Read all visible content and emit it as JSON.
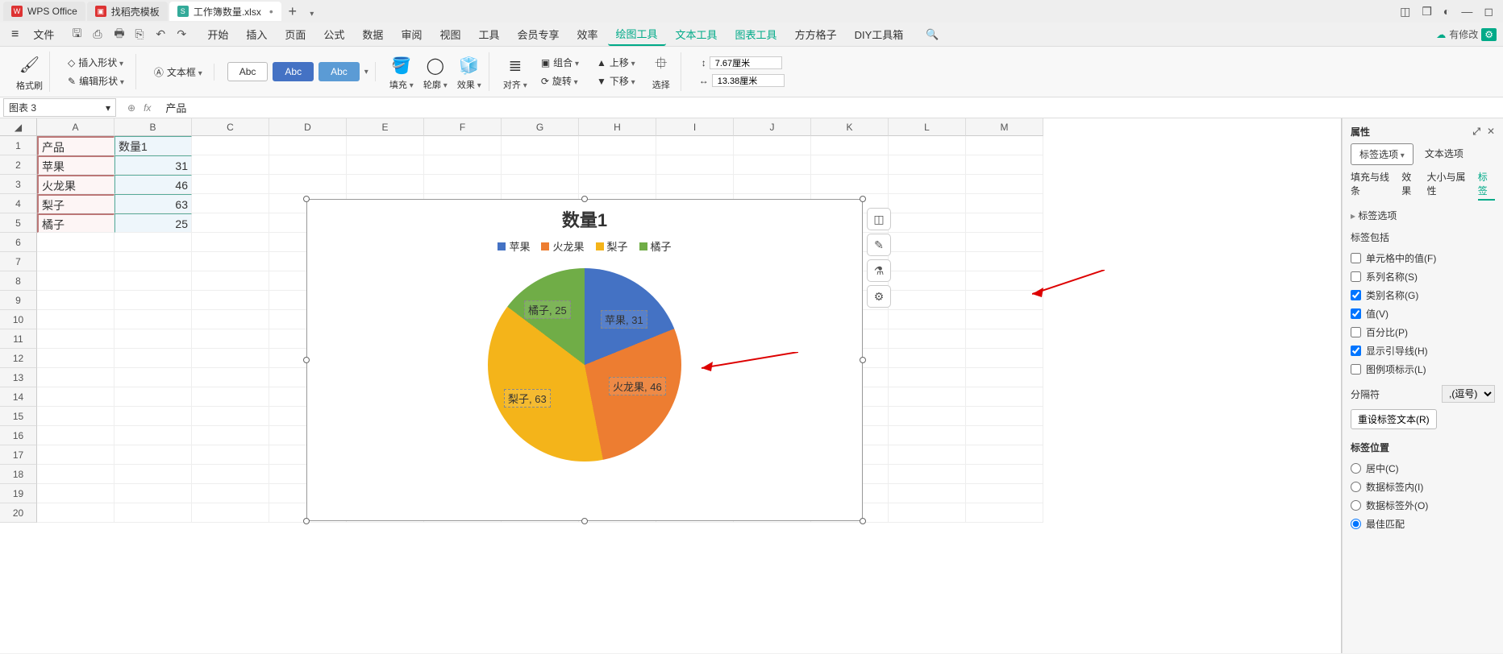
{
  "titlebar": {
    "tabs": [
      {
        "label": "WPS Office",
        "icon_bg": "#d33",
        "icon_text": "W"
      },
      {
        "label": "找稻壳模板",
        "icon_bg": "#d33",
        "icon_text": "▣"
      },
      {
        "label": "工作簿数量.xlsx",
        "icon_bg": "#3a9",
        "icon_text": "S"
      }
    ]
  },
  "menubar": {
    "file": "文件",
    "items": [
      "开始",
      "插入",
      "页面",
      "公式",
      "数据",
      "审阅",
      "视图",
      "工具",
      "会员专享",
      "效率",
      "绘图工具",
      "文本工具",
      "图表工具",
      "方方格子",
      "DIY工具箱"
    ],
    "modify": "有修改"
  },
  "ribbon": {
    "format_brush": "格式刷",
    "insert_shape": "插入形状",
    "text_box": "文本框",
    "edit_shape": "编辑形状",
    "style_abc": "Abc",
    "fill": "填充",
    "outline": "轮廓",
    "effect": "效果",
    "align": "对齐",
    "group": "组合",
    "rotate": "旋转",
    "up": "上移",
    "down": "下移",
    "select": "选择",
    "h": "7.67厘米",
    "w": "13.38厘米"
  },
  "sheet": {
    "namebox": "图表 3",
    "formula": "产品",
    "cols": [
      "A",
      "B",
      "C",
      "D",
      "E",
      "F",
      "G",
      "H",
      "I",
      "J",
      "K",
      "L",
      "M"
    ],
    "data": [
      [
        "产品",
        "数量1"
      ],
      [
        "苹果",
        "31"
      ],
      [
        "火龙果",
        "46"
      ],
      [
        "梨子",
        "63"
      ],
      [
        "橘子",
        "25"
      ]
    ]
  },
  "chart_data": {
    "type": "pie",
    "title": "数量1",
    "series_name": "数量1",
    "categories": [
      "苹果",
      "火龙果",
      "梨子",
      "橘子"
    ],
    "values": [
      31,
      46,
      63,
      25
    ],
    "colors": [
      "#4472c4",
      "#ed7d31",
      "#f4b41a",
      "#70ad47"
    ],
    "data_labels": [
      "苹果, 31",
      "火龙果, 46",
      "梨子, 63",
      "橘子, 25"
    ],
    "legend_position": "top"
  },
  "panel": {
    "title": "属性",
    "tab_label_opts": "标签选项",
    "tab_text_opts": "文本选项",
    "subtabs": [
      "填充与线条",
      "效果",
      "大小与属性",
      "标签"
    ],
    "sect_label_opts": "标签选项",
    "sect_include": "标签包括",
    "cb_cellval": "单元格中的值(F)",
    "cb_series": "系列名称(S)",
    "cb_category": "类别名称(G)",
    "cb_value": "值(V)",
    "cb_percent": "百分比(P)",
    "cb_leader": "显示引导线(H)",
    "cb_legendkey": "图例项标示(L)",
    "separator_label": "分隔符",
    "separator_value": ",(逗号)",
    "reset": "重设标签文本(R)",
    "sect_position": "标签位置",
    "rb_center": "居中(C)",
    "rb_inside": "数据标签内(I)",
    "rb_outside": "数据标签外(O)",
    "rb_bestfit": "最佳匹配"
  }
}
